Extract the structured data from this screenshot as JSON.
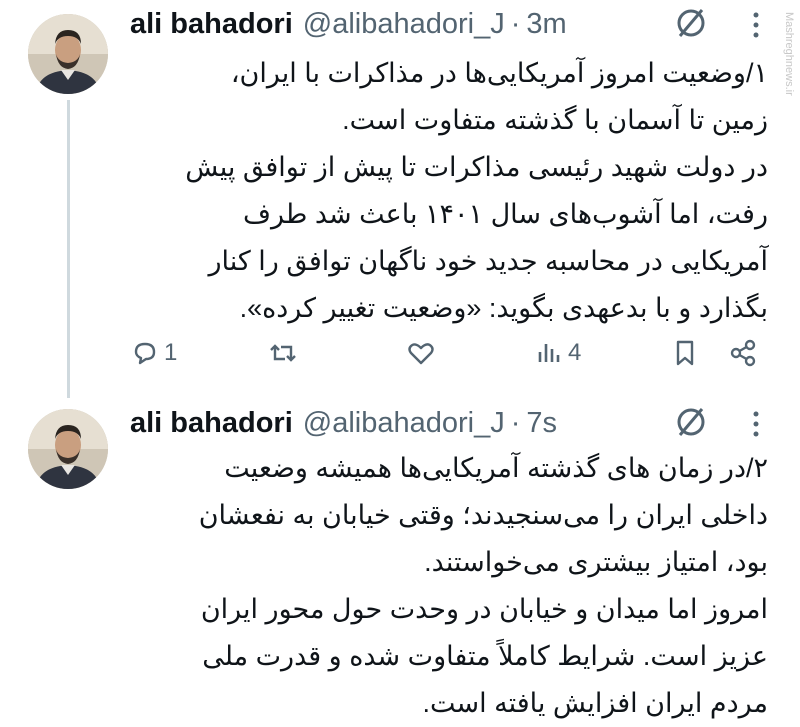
{
  "tweets": [
    {
      "name": "ali bahadori",
      "handle": "@alibahadori_J",
      "separator": "·",
      "time": "3m",
      "text": "۱/وضعیت امروز آمریکایی‌ها در مذاکرات با ایران،\nزمین تا آسمان با گذشته متفاوت است.\nدر دولت شهید رئیسی مذاکرات تا پیش از توافق پیش\nرفت، اما آشوب‌های سال ۱۴۰۱ باعث شد طرف\nآمریکایی در محاسبه جدید خود ناگهان توافق را کنار\nبگذارد و با بدعهدی بگوید: «وضعیت تغییر کرده».",
      "actions": {
        "reply_count": "1",
        "views_count": "4"
      }
    },
    {
      "name": "ali bahadori",
      "handle": "@alibahadori_J",
      "separator": "·",
      "time": "7s",
      "text": "۲/در زمان های گذشته آمریکایی‌ها همیشه وضعیت\nداخلی ایران را می‌سنجیدند؛ وقتی خیابان به نفعشان\nبود، امتیاز بیشتری می‌خواستند.\nامروز اما میدان و خیابان در وحدت حول محور ایران\nعزیز است. شرایط کاملاً متفاوت شده و قدرت ملی\nمردم ایران افزایش یافته است."
    }
  ],
  "icons": {
    "mute": "mute-icon",
    "more": "more-vertical-icon",
    "reply": "reply-icon",
    "retweet": "retweet-icon",
    "like": "heart-icon",
    "views": "views-icon",
    "bookmark": "bookmark-icon",
    "share": "share-icon"
  },
  "watermark": "Mashreghnews.ir",
  "colors": {
    "text": "#0f1419",
    "secondary": "#536471",
    "thread_line": "#cfd9de",
    "background": "#ffffff"
  }
}
